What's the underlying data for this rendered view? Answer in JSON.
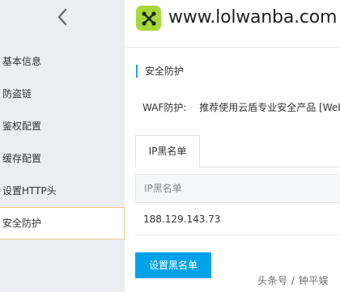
{
  "sidebar": {
    "back_icon": "chevron-left-icon",
    "items": [
      {
        "label": "基本信息",
        "active": false
      },
      {
        "label": "防盗链",
        "active": false
      },
      {
        "label": "鉴权配置",
        "active": false
      },
      {
        "label": "缓存配置",
        "active": false
      },
      {
        "label": "设置HTTP头",
        "active": false
      },
      {
        "label": "安全防护",
        "active": true
      }
    ]
  },
  "header": {
    "domain": "www.lolwanba.com",
    "logo_icon": "cross-logo-icon",
    "logo_color": "#a7d93b"
  },
  "main": {
    "section_title": "安全防护",
    "waf": {
      "label": "WAF防护:",
      "text": "推荐使用云盾专业安全产品 [Web"
    },
    "tabs": [
      {
        "label": "IP黑名单",
        "active": true
      }
    ],
    "table": {
      "columns": [
        "IP黑名单"
      ],
      "rows": [
        [
          "188.129.143.73"
        ]
      ]
    },
    "button_label": "设置黑名单"
  },
  "watermark": "头条号 / 钟平娱",
  "colors": {
    "accent": "#00a2ea",
    "section_bar": "#1aa6e5",
    "active_border": "#f2c88a",
    "sidebar_bg": "#eaedf1"
  }
}
